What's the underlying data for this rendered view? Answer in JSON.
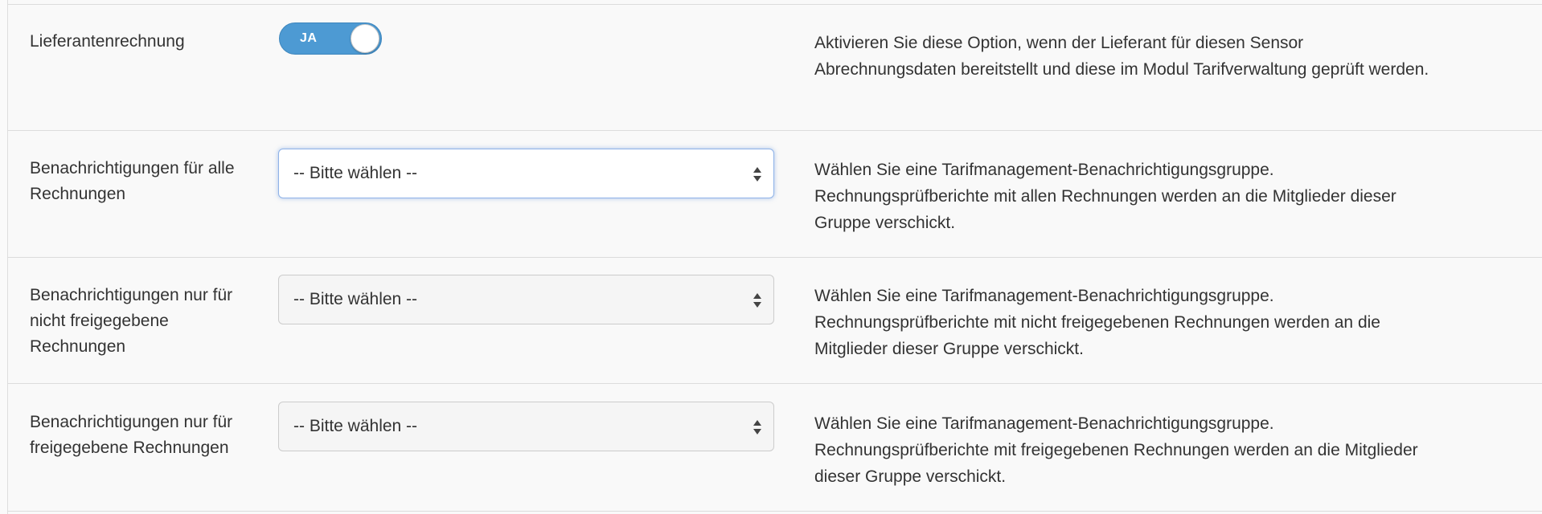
{
  "colors": {
    "toggle_on": "#4d9ad3",
    "focus_border": "#8fb3e8",
    "text": "#333333",
    "divider": "#dcdcdc"
  },
  "rows": [
    {
      "label": "Lieferantenrechnung",
      "control": "toggle",
      "toggle_text": "JA",
      "toggle_on": true,
      "help": "Aktivieren Sie diese Option, wenn der Lieferant für diesen Sensor Abrechnungsdaten bereitstellt und diese im Modul Tarifverwaltung geprüft werden."
    },
    {
      "label": "Benachrichtigungen für alle Rechnungen",
      "control": "select",
      "select_value": "-- Bitte wählen --",
      "focused": true,
      "help": "Wählen Sie eine Tarifmanagement-Benachrichtigungsgruppe. Rechnungsprüfberichte mit allen Rechnungen werden an die Mitglieder dieser Gruppe verschickt."
    },
    {
      "label": "Benachrichtigungen nur für nicht freigegebene Rechnungen",
      "control": "select",
      "select_value": "-- Bitte wählen --",
      "focused": false,
      "help": "Wählen Sie eine Tarifmanagement-Benachrichtigungsgruppe. Rechnungsprüfberichte mit nicht freigegebenen Rechnungen werden an die Mitglieder dieser Gruppe verschickt."
    },
    {
      "label": "Benachrichtigungen nur für freigegebene Rechnungen",
      "control": "select",
      "select_value": "-- Bitte wählen --",
      "focused": false,
      "help": "Wählen Sie eine Tarifmanagement-Benachrichtigungsgruppe. Rechnungsprüfberichte mit freigegebenen Rechnungen werden an die Mitglieder dieser Gruppe verschickt."
    }
  ]
}
